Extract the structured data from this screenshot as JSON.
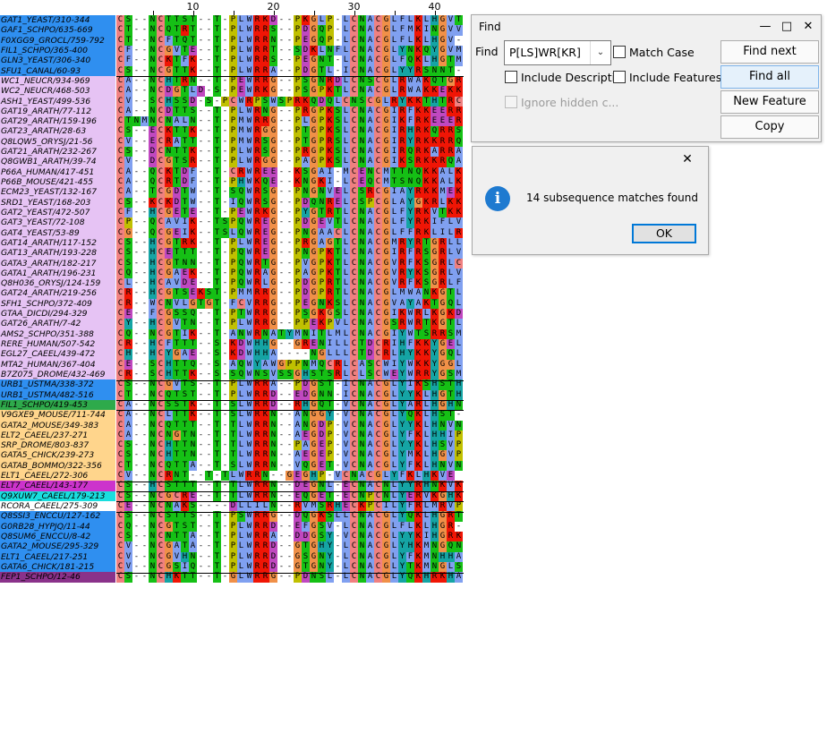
{
  "ruler": {
    "ticks": [
      "10",
      "20",
      "30",
      "40"
    ]
  },
  "sequences": [
    {
      "name": "GAT1_YEAST/310-344",
      "seq": "CS--NCTTST--T-PLWRKD--PKGLP-LCNACGLFLKLHGVT",
      "group": "blue"
    },
    {
      "name": "GAF1_SCHPO/635-669",
      "seq": "CT--NCQTRT--T-PLWRRS--PDGQP-LCNACGLFMKINGVVR",
      "group": "blue"
    },
    {
      "name": "F0XGG9_GROCL/759-792",
      "seq": "CT--NCFTQT--T-PLWRRN--PEGQP-LCNACGLFLKLHGV-",
      "group": "blue"
    },
    {
      "name": "FIL1_SCHPO/365-400",
      "seq": "CF--NCGVTE--T-PLWRRT--SDKLNFLCNACGLYNKQYGVM",
      "group": "blue"
    },
    {
      "name": "GLN3_YEAST/306-340",
      "seq": "CF--NCKTFK--T-PLWRRS--PEGNT-LCNACGLFQKLHGTM",
      "group": "blue"
    },
    {
      "name": "SFU1_CANAL/60-93",
      "seq": "CS--NCGTTK--T-PLWRRA--PDGTL-ICNACGLYYRSNNT-",
      "group": "blue"
    },
    {
      "name": "WC1_NEUCR/934-969",
      "seq": "CA--NCHTRN--T-PEWRRG--PSGNRDLCNSCGLRWAKQTGR",
      "group": "pink"
    },
    {
      "name": "WC2_NEUCR/468-503",
      "seq": "CA--NCDGTLD-S-PEWRKG--PSGPKTLCNACGLRWAKKEKK",
      "group": "pink"
    },
    {
      "name": "ASH1_YEAST/499-536",
      "seq": "CV--SCHSSD-S-PCWRPSWSPRKQDQLCNSCGLRYKKTHTRC",
      "group": "pink"
    },
    {
      "name": "GAT19_ARATH/77-112",
      "seq": "CA--NCDTTS--T-PLWRNG--PRGPKSLCNACGIRFKKEERR",
      "group": "pink"
    },
    {
      "name": "GAT29_ARATH/159-196",
      "seq": "CTNMNCNALN--T-PMWRRG--PLGPKSLCNACGIKFRKEEER",
      "group": "pink"
    },
    {
      "name": "GAT23_ARATH/28-63",
      "seq": "CS--ECKTTK--T-PMWRGG--PTGPKSLCNACGIRHRKQRRS",
      "group": "pink"
    },
    {
      "name": "Q8LQW5_ORYSJ/21-56",
      "seq": "CV--ECRATT--T-PMWRSG--PTGPRSLCNACGIRYRKKRRQ",
      "group": "pink"
    },
    {
      "name": "GAT21_ARATH/232-267",
      "seq": "CS--DCNTTK--T-PLWRSG--PRGPKSLCNACGIRQRKARRA",
      "group": "pink"
    },
    {
      "name": "Q8GWB1_ARATH/39-74",
      "seq": "CV--DCGTSR--T-PLWRGG--PAGPKSLCNACGIKSRKKRQA",
      "group": "pink"
    },
    {
      "name": "P66A_HUMAN/417-451",
      "seq": "CA--QCKTDF--T-CRWREE--KSGAI-MCENCMTTNQKKALK",
      "group": "pink"
    },
    {
      "name": "P66B_MOUSE/421-455",
      "seq": "CA--QCRTDF--T-PHWKQE--KNGKI-LCEQCMTSNQKKALK",
      "group": "pink"
    },
    {
      "name": "ECM23_YEAST/132-167",
      "seq": "CA--TCGDTW--T-SQWRSG--PNGNVELCSRCGIAYRKKMEK",
      "group": "pink"
    },
    {
      "name": "SRD1_YEAST/168-203",
      "seq": "CS--KCKDTW--T-IQWRSG--PDQNRELCSPCGLAYGKRLKK",
      "group": "pink"
    },
    {
      "name": "GAT2_YEAST/472-507",
      "seq": "CF--HCGETE--T-PEWRKG--PYGTRTLCNACGLFYRKVTKK",
      "group": "pink"
    },
    {
      "name": "GAT3_YEAST/72-108",
      "seq": "CP--QCAVIK--TSPQWREG--PDGEVTLCNACGLFYRKIFLV",
      "group": "pink"
    },
    {
      "name": "GAT4_YEAST/53-89",
      "seq": "CG--QCGEIK--TSLQWREG--PNGAACLCNACGLFFRKLILR",
      "group": "pink"
    },
    {
      "name": "GAT14_ARATH/117-152",
      "seq": "CS--HCGTRK--T-PLWREG--PRGAGTLCNACGMRYRTGRLL",
      "group": "pink"
    },
    {
      "name": "GAT13_ARATH/193-228",
      "seq": "CS--HCETTT--T-PQWREG--PNGPKTLCNACGIRFRSGRLV",
      "group": "pink"
    },
    {
      "name": "GATA3_ARATH/182-217",
      "seq": "CS--HCGTNN--T-PQWRTG--PVGPKTLCNACGVRFKSGRLC",
      "group": "pink"
    },
    {
      "name": "GATA1_ARATH/196-231",
      "seq": "CQ--HCGAEK--T-PQWRAG--PAGPKTLCNACGVRYKSGRLV",
      "group": "pink"
    },
    {
      "name": "Q8H036_ORYSJ/124-159",
      "seq": "CL--HCAVDE--T-PQWRLG--PDGPRTLCNACGVRFKSGRLF",
      "group": "pink"
    },
    {
      "name": "GAT24_ARATH/219-256",
      "seq": "CR--HCGTSEKST-PMMRRG--PDGPRTLCNACGLMWANKGTL",
      "group": "pink"
    },
    {
      "name": "SFH1_SCHPO/372-409",
      "seq": "CR--WCNVLGTGT-FCVRRG--PEGNKSLCNACGVAYAKTGQL",
      "group": "pink"
    },
    {
      "name": "GTAA_DICDI/294-329",
      "seq": "CE--FCGSSQ--T-PTWRRG--PSGKGSLCNACGIKWRLKGKD",
      "group": "pink"
    },
    {
      "name": "GAT26_ARATH/7-42",
      "seq": "CY--HCGVTN--T-PLWRRG--PPEKPVLCNACGSRWRTKGTL",
      "group": "pink"
    },
    {
      "name": "AMS2_SCHPO/351-388",
      "seq": "CQ--NCGTIK--T-ANWRNATYMNITLMLCNACGIYWTSRRSM",
      "group": "pink"
    },
    {
      "name": "RERE_HUMAN/507-542",
      "seq": "CR--HCFTTT--S-KDWHHG--GRENILLCTDCRIHFKKYGEL",
      "group": "pink"
    },
    {
      "name": "EGL27_CAEEL/439-472",
      "seq": "CH--HCYGAE--S-KDWHHA----NGLLLCTDCRLHYKKYGQL",
      "group": "pink"
    },
    {
      "name": "MTA2_HUMAN/367-404",
      "seq": "CE--SCHTTQ--S-AQWYAWGPPNMQCRLCASCWIYWKKYGGL",
      "group": "pink"
    },
    {
      "name": "B7Z075_DROME/432-469",
      "seq": "CR--SCHTTK--S-SQWNSVSSGHSTSRLCLSCWEYWRRYGSM",
      "group": "pink"
    },
    {
      "name": "URB1_USTMA/338-372",
      "seq": "CS--NCGVTS--T-PLWRRA--PDGST-ICNACGLYIKSHSTH",
      "group": "blue"
    },
    {
      "name": "URB1_USTMA/482-516",
      "seq": "CT--NCQTST--T-PLWRRD--EDGNN-ICNACGLYYKLHGTH",
      "group": "blue"
    },
    {
      "name": "FIL1_SCHPO/419-453",
      "seq": "CA--NCSSTK--T-SLWRRD--RHGQT-VCNACGLYARLHGHN",
      "group": "green"
    },
    {
      "name": "V9GXE9_MOUSE/711-744",
      "seq": "CA--NCLTTK--T-SLWRKN--ANGGY-VCNACGLYQKLHST-",
      "group": "orange"
    },
    {
      "name": "GATA2_MOUSE/349-383",
      "seq": "CA--NCQTTT--T-TLWRRN--ANGDP-VCNACGLYYKLHNVN",
      "group": "orange"
    },
    {
      "name": "ELT2_CAEEL/237-271",
      "seq": "CA--NCNGTN--T-TLWRRN--AEGDP-VCNACGLYFKLHHIP",
      "group": "orange"
    },
    {
      "name": "SRP_DROME/803-837",
      "seq": "CS--NCHTTN--T-TLWRRN--PAGEP-VCNACGLYYKLHSVP",
      "group": "orange"
    },
    {
      "name": "GATA5_CHICK/239-273",
      "seq": "CS--NCHTTN--T-TLWRRN--AEGEP-VCNACGLYMKLHGVP",
      "group": "orange"
    },
    {
      "name": "GATAB_BOMMO/322-356",
      "seq": "CT--NCQTTA--T-SLWRRN--VQGET-VCNACGLYFKLHNVN",
      "group": "orange"
    },
    {
      "name": "ELT1_CAEEL/272-306",
      "seq": "CV--NCRNT--T-TLWRRN--GEGHP-VCNACGLYFKLHKVE",
      "group": "orange"
    },
    {
      "name": "ELT7_CAEEL/143-177",
      "seq": "CS--HCSTTT--T-TLWRRN--DEGNL-ECNACNLYYRHNKVK",
      "group": "magenta"
    },
    {
      "name": "Q9XUW7_CAEEL/179-213",
      "seq": "CS--NCGCRE--T-TLWRRN--EQGET-ECNPCNLYERVKGHK",
      "group": "cyan"
    },
    {
      "name": "RCORA_CAEEL/275-309",
      "seq": "CE--NCNAKS----DLLILN--RVMSRHECKPCILYFRLMRVP",
      "group": "white"
    },
    {
      "name": "Q8SSI3_ENCCU/127-162",
      "seq": "CS--NCSTTS--T-PSWRRG--DQGKSLLCNACGLYQKLHGRT",
      "group": "blue"
    },
    {
      "name": "G0RB28_HYPJQ/11-44",
      "seq": "CQ--NCGTST--T-PLWRRD--EFGSV-LCNACGLFLKLHGR-",
      "group": "blue"
    },
    {
      "name": "Q8SUM6_ENCCU/8-42",
      "seq": "CS--NCNTTA--T-PLWRRA--DDGSY-VCNACGLYYKIHGRK",
      "group": "blue"
    },
    {
      "name": "GATA2_MOUSE/295-329",
      "seq": "CV--NCGATA--T-PLWRRD--GTGHY-LCNACGLYHKMNGQN",
      "group": "blue"
    },
    {
      "name": "ELT1_CAEEL/217-251",
      "seq": "CV--NCGVHN--T-PLWRRD--GSGNY-LCNACGLYFKMNHHA",
      "group": "blue"
    },
    {
      "name": "GATA6_CHICK/181-215",
      "seq": "CV--NCGSIQ--T-PLWRRD--GTGNY-LCNACGLYTKMNGLS",
      "group": "blue"
    },
    {
      "name": "FEP1_SCHPO/12-46",
      "seq": "CS--NCHKTT--T-GLWRRG--PDNSL-LCNACGLYQKHRKHA",
      "group": "purple"
    }
  ],
  "colors": {
    "group": {
      "blue": "#2f8ff0",
      "pink": "#e6c3f4",
      "green": "#2eaa4b",
      "orange": "#ffd58c",
      "magenta": "#cc33cc",
      "cyan": "#19dede",
      "white": "#ffffff",
      "purple": "#8a328a"
    },
    "residue": {
      "C": "#f08080",
      "A": "#80a0f0",
      "I": "#80a0f0",
      "L": "#80a0f0",
      "M": "#80a0f0",
      "F": "#80a0f0",
      "W": "#80a0f0",
      "V": "#80a0f0",
      "K": "#f01505",
      "R": "#f01505",
      "E": "#c048c0",
      "D": "#c048c0",
      "N": "#15c015",
      "Q": "#15c015",
      "S": "#15c015",
      "T": "#15c015",
      "G": "#f09048",
      "P": "#c0c000",
      "H": "#15a4a4",
      "Y": "#15a4a4"
    }
  },
  "find_dialog": {
    "title": "Find",
    "find_label": "Find",
    "find_value": "P[LS]WR[KR]",
    "match_case": "Match Case",
    "include_descriptions": "Include Descripti...",
    "include_features": "Include Features",
    "ignore_hidden": "Ignore hidden c...",
    "buttons": {
      "find_next": "Find next",
      "find_all": "Find all",
      "new_feature": "New Feature",
      "copy": "Copy"
    }
  },
  "message_dialog": {
    "text": "14 subsequence matches found",
    "ok": "OK"
  }
}
